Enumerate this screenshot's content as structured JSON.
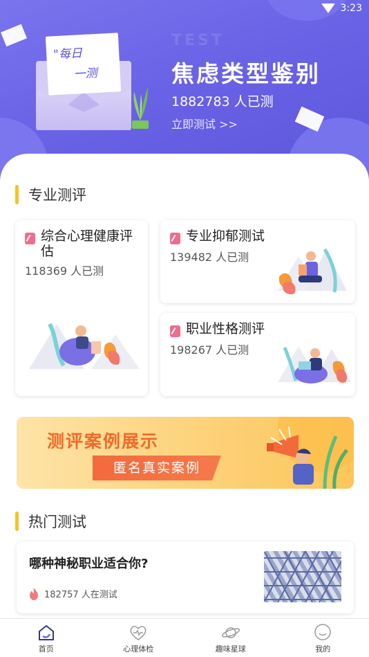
{
  "status_bar": {
    "time": "3:23"
  },
  "hero": {
    "letter_line1": "\"每日",
    "letter_line2": "一测",
    "ghost_text": "TEST",
    "title": "焦虑类型鉴别",
    "count_text": "1882783  人已测",
    "link_text": "立即测试 >>",
    "bg_color": "#6a63e6"
  },
  "professional": {
    "section_title": "专业测评",
    "cards": [
      {
        "title": "综合心理健康评估",
        "count": "118369 人已测"
      },
      {
        "title": "专业抑郁测试",
        "count": "139482 人已测"
      },
      {
        "title": "职业性格测评",
        "count": "198267 人已测"
      }
    ]
  },
  "banner": {
    "title": "测评案例展示",
    "button": "匿名真实案例"
  },
  "hot": {
    "section_title": "热门测试",
    "items": [
      {
        "title": "哪种神秘职业适合你?",
        "stat": "182757 人在测试"
      }
    ]
  },
  "tabs": [
    {
      "label": "首页",
      "icon": "home-icon",
      "active": true
    },
    {
      "label": "心理体检",
      "icon": "heart-check-icon",
      "active": false
    },
    {
      "label": "趣味星球",
      "icon": "planet-icon",
      "active": false
    },
    {
      "label": "我的",
      "icon": "smile-icon",
      "active": false
    }
  ],
  "colors": {
    "accent": "#f5c321",
    "tag": "#f06c8f",
    "banner_text": "#f06a2a"
  }
}
